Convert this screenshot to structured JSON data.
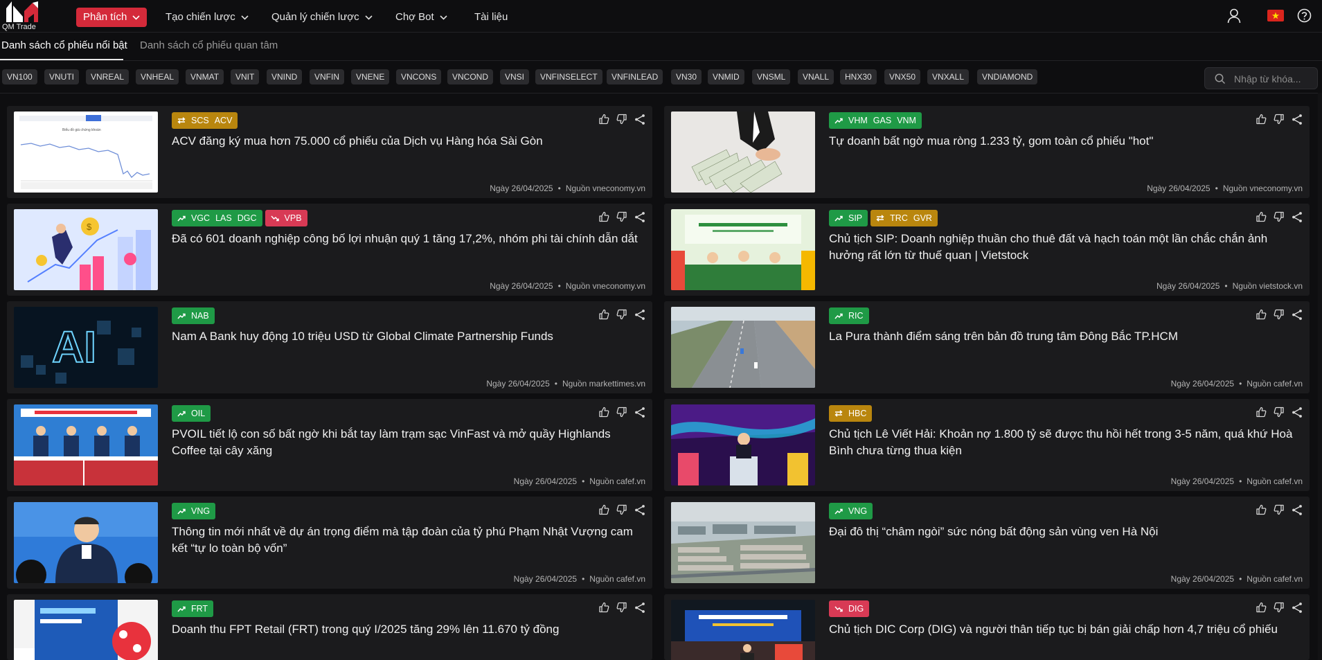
{
  "logo": {
    "text": "QM Trade"
  },
  "nav": [
    {
      "label": "Phân tích",
      "active": true,
      "dropdown": true
    },
    {
      "label": "Tạo chiến lược",
      "active": false,
      "dropdown": true
    },
    {
      "label": "Quản lý chiến lược",
      "active": false,
      "dropdown": true
    },
    {
      "label": "Chợ Bot",
      "active": false,
      "dropdown": true
    },
    {
      "label": "Tài liệu",
      "active": false,
      "dropdown": false
    }
  ],
  "subtabs": [
    {
      "label": "Danh sách cổ phiếu nổi bật",
      "active": true
    },
    {
      "label": "Danh sách cổ phiếu quan tâm",
      "active": false
    }
  ],
  "search": {
    "placeholder": "Nhập từ khóa..."
  },
  "indices": [
    "VN100",
    "VNUTI",
    "VNREAL",
    "VNHEAL",
    "VNMAT",
    "VNIT",
    "VNIND",
    "VNFIN",
    "VNENE",
    "VNCONS",
    "VNCOND",
    "VNSI",
    "VNFINSELECT",
    "VNFINLEAD",
    "VN30",
    "VNMID",
    "VNSML",
    "VNALL",
    "HNX30",
    "VNX50",
    "VNXALL",
    "VNDIAMOND"
  ],
  "colors": {
    "accent": "#d42a3a",
    "up": "#1f9a46",
    "flat": "#b9860e",
    "down": "#d83a55"
  },
  "articles": [
    {
      "tags": [
        {
          "trend": "flat",
          "symbols": [
            "SCS",
            "ACV"
          ]
        }
      ],
      "title": "ACV đăng ký mua hơn 75.000 cổ phiếu của Dịch vụ Hàng hóa Sài Gòn",
      "date": "Ngày 26/04/2025",
      "source": "Nguồn vneconomy.vn",
      "thumb": "chart"
    },
    {
      "tags": [
        {
          "trend": "up",
          "symbols": [
            "VHM",
            "GAS",
            "VNM"
          ]
        }
      ],
      "title": "Tự doanh bất ngờ mua ròng 1.233 tỷ, gom toàn cổ phiếu \"hot\"",
      "date": "Ngày 26/04/2025",
      "source": "Nguồn vneconomy.vn",
      "thumb": "money"
    },
    {
      "tags": [
        {
          "trend": "up",
          "symbols": [
            "VGC",
            "LAS",
            "DGC"
          ]
        },
        {
          "trend": "down",
          "symbols": [
            "VPB"
          ]
        }
      ],
      "title": "Đã có 601 doanh nghiệp công bố lợi nhuận quý 1 tăng 17,2%, nhóm phi tài chính dẫn dắt",
      "date": "Ngày 26/04/2025",
      "source": "Nguồn vneconomy.vn",
      "thumb": "growth"
    },
    {
      "tags": [
        {
          "trend": "up",
          "symbols": [
            "SIP"
          ]
        },
        {
          "trend": "flat",
          "symbols": [
            "TRC",
            "GVR"
          ]
        }
      ],
      "title": "Chủ tịch SIP: Doanh nghiệp thuần cho thuê đất và hạch toán một lần chắc chắn ảnh hưởng rất lớn từ thuế quan | Vietstock",
      "date": "Ngày 26/04/2025",
      "source": "Nguồn vietstock.vn",
      "thumb": "meeting-green"
    },
    {
      "tags": [
        {
          "trend": "up",
          "symbols": [
            "NAB"
          ]
        }
      ],
      "title": "Nam A Bank huy động 10 triệu USD từ Global Climate Partnership Funds",
      "date": "Ngày 26/04/2025",
      "source": "Nguồn markettimes.vn",
      "thumb": "ai"
    },
    {
      "tags": [
        {
          "trend": "up",
          "symbols": [
            "RIC"
          ]
        }
      ],
      "title": "La Pura thành điểm sáng trên bản đồ trung tâm Đông Bắc TP.HCM",
      "date": "Ngày 26/04/2025",
      "source": "Nguồn cafef.vn",
      "thumb": "road"
    },
    {
      "tags": [
        {
          "trend": "up",
          "symbols": [
            "OIL"
          ]
        }
      ],
      "title": "PVOIL tiết lộ con số bất ngờ khi bắt tay làm trạm sạc VinFast và mở quầy Highlands Coffee tại cây xăng",
      "date": "Ngày 26/04/2025",
      "source": "Nguồn cafef.vn",
      "thumb": "meeting-blue"
    },
    {
      "tags": [
        {
          "trend": "flat",
          "symbols": [
            "HBC"
          ]
        }
      ],
      "title": "Chủ tịch Lê Viết Hải: Khoản nợ 1.800 tỷ sẽ được thu hồi hết trong 3-5 năm, quá khứ Hoà Bình chưa từng thua kiện",
      "date": "Ngày 26/04/2025",
      "source": "Nguồn cafef.vn",
      "thumb": "speaker"
    },
    {
      "tags": [
        {
          "trend": "up",
          "symbols": [
            "VNG"
          ]
        }
      ],
      "title": "Thông tin mới nhất về dự án trọng điểm mà tập đoàn của tỷ phú Phạm Nhật Vượng cam kết “tự lo toàn bộ vốn”",
      "date": "Ngày 26/04/2025",
      "source": "Nguồn cafef.vn",
      "thumb": "person"
    },
    {
      "tags": [
        {
          "trend": "up",
          "symbols": [
            "VNG"
          ]
        }
      ],
      "title": "Đại đô thị “châm ngòi” sức nóng bất động sản vùng ven Hà Nội",
      "date": "Ngày 26/04/2025",
      "source": "Nguồn cafef.vn",
      "thumb": "city"
    },
    {
      "tags": [
        {
          "trend": "up",
          "symbols": [
            "FRT"
          ]
        }
      ],
      "title": "Doanh thu FPT Retail (FRT) trong quý I/2025 tăng 29% lên 11.670 tỷ đồng",
      "date": "",
      "source": "",
      "thumb": "store"
    },
    {
      "tags": [
        {
          "trend": "down",
          "symbols": [
            "DIG"
          ]
        }
      ],
      "title": "Chủ tịch DIC Corp (DIG) và người thân tiếp tục bị bán giải chấp hơn 4,7 triệu cổ phiếu",
      "date": "",
      "source": "",
      "thumb": "stage"
    }
  ]
}
